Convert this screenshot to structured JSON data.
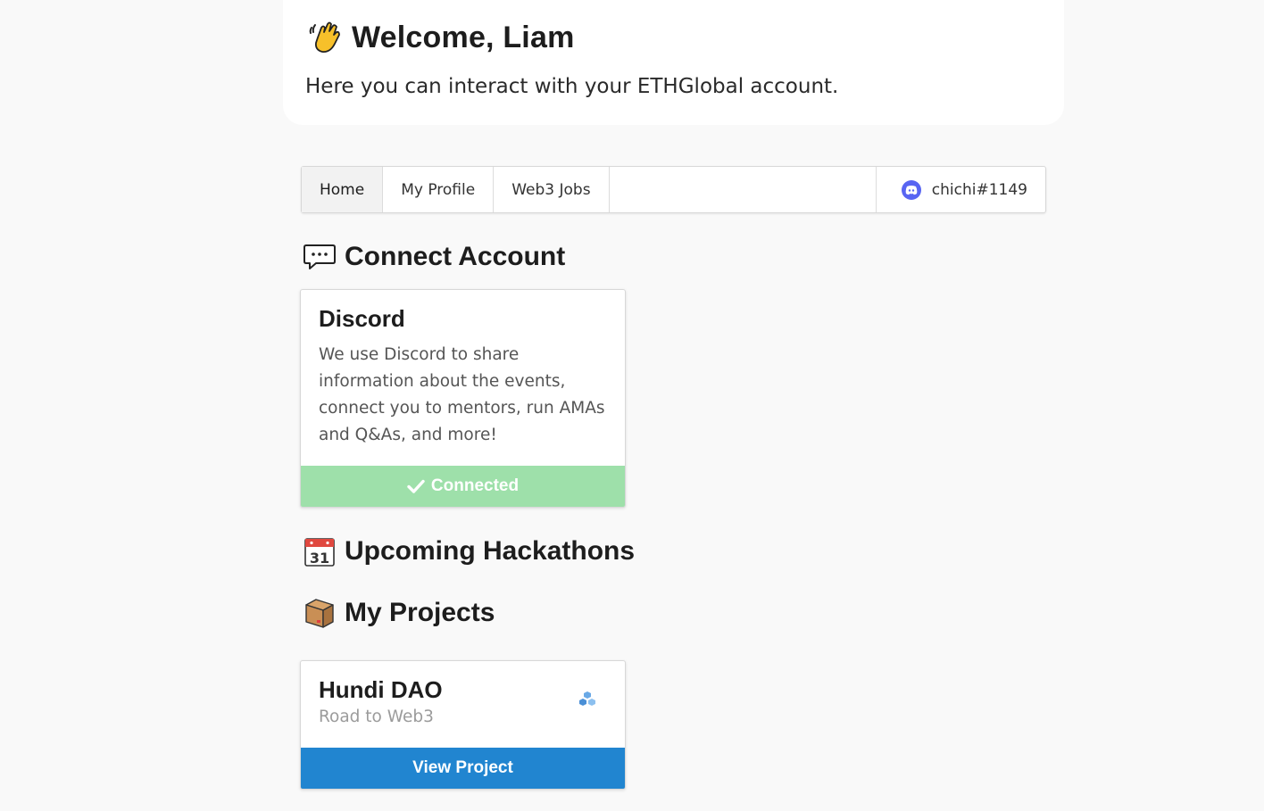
{
  "welcome": {
    "title": "Welcome, Liam",
    "subtitle": "Here you can interact with your ETHGlobal account.",
    "icon": "waving-hand-icon"
  },
  "tabs": {
    "items": [
      {
        "label": "Home",
        "active": true
      },
      {
        "label": "My Profile",
        "active": false
      },
      {
        "label": "Web3 Jobs",
        "active": false
      }
    ],
    "user": {
      "label": "chichi#1149",
      "icon": "discord-icon"
    }
  },
  "connect": {
    "title": "Connect Account",
    "icon": "speech-bubble-icon",
    "card": {
      "title": "Discord",
      "text": "We use Discord to share information about the events, connect you to mentors, run AMAs and Q&As, and more!",
      "status_label": "Connected",
      "status_icon": "check-icon"
    }
  },
  "hackathons": {
    "title": "Upcoming Hackathons",
    "icon": "calendar-icon"
  },
  "projects": {
    "title": "My Projects",
    "icon": "package-icon",
    "items": [
      {
        "name": "Hundi DAO",
        "event": "Road to Web3",
        "badge_icon": "blocks-icon",
        "button_label": "View Project"
      }
    ]
  },
  "colors": {
    "background": "#f9f9f9",
    "connected": "#9ee0aa",
    "primary_button": "#2185d0",
    "discord": "#5865f2"
  }
}
